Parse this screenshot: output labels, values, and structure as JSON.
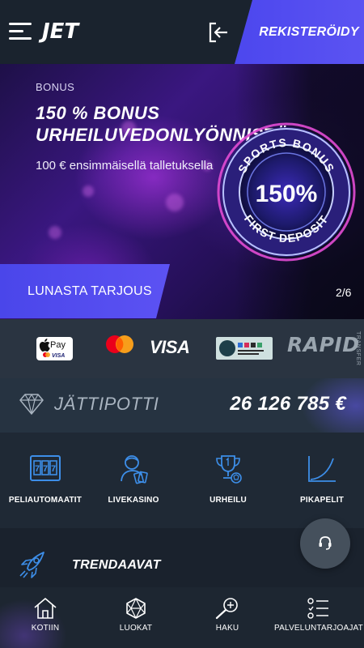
{
  "header": {
    "logo": "JET",
    "register_label": "REKISTERÖIDY",
    "icons": {
      "menu": "hamburger-menu-icon",
      "login": "login-icon"
    }
  },
  "banner": {
    "kicker": "BONUS",
    "title_line1": "150 % BONUS",
    "title_line2": "URHEILUVEDONLYÖNNISTÄ",
    "subtitle": "100 € ensimmäisellä talletuksella",
    "badge": {
      "top_text": "SPORTS BONUS",
      "value": "150%",
      "bottom_text": "FIRST DEPOSIT"
    },
    "cta_label": "LUNASTA TARJOUS",
    "slide_counter": "2/6"
  },
  "payments": {
    "items": [
      "Apple Pay",
      "Mastercard",
      "VISA",
      "Rahakeskus",
      "RAPID"
    ],
    "applepay_text": "Pay",
    "applepay_sub": "VISA",
    "visa_text": "VISA",
    "rapid_text": "RAPID",
    "rapid_sub": "TRANSFER"
  },
  "jackpot": {
    "label": "JÄTTIPOTTI",
    "amount": "26 126 785 €",
    "icon": "diamond-icon"
  },
  "categories": [
    {
      "label": "PELIAUTOMAATIT",
      "icon": "slot-machine-icon"
    },
    {
      "label": "LIVEKASINO",
      "icon": "live-dealer-icon"
    },
    {
      "label": "URHEILU",
      "icon": "trophy-icon"
    },
    {
      "label": "PIKAPELIT",
      "icon": "curve-chart-icon"
    }
  ],
  "trending": {
    "label": "TRENDAAVAT",
    "icon": "rocket-icon"
  },
  "support": {
    "icon": "headset-icon"
  },
  "bottom_nav": [
    {
      "label": "KOTIIN",
      "icon": "home-icon"
    },
    {
      "label": "LUOKAT",
      "icon": "dice-icon"
    },
    {
      "label": "HAKU",
      "icon": "search-icon"
    },
    {
      "label": "PALVELUNTARJOAJAT",
      "icon": "providers-list-icon"
    }
  ],
  "colors": {
    "accent": "#5049ee",
    "header_bg": "#1a232e",
    "payments_bg": "#2a3441",
    "jackpot_bg": "#263341",
    "categories_bg": "#1f2935",
    "icon_blue": "#3d8ee8"
  }
}
